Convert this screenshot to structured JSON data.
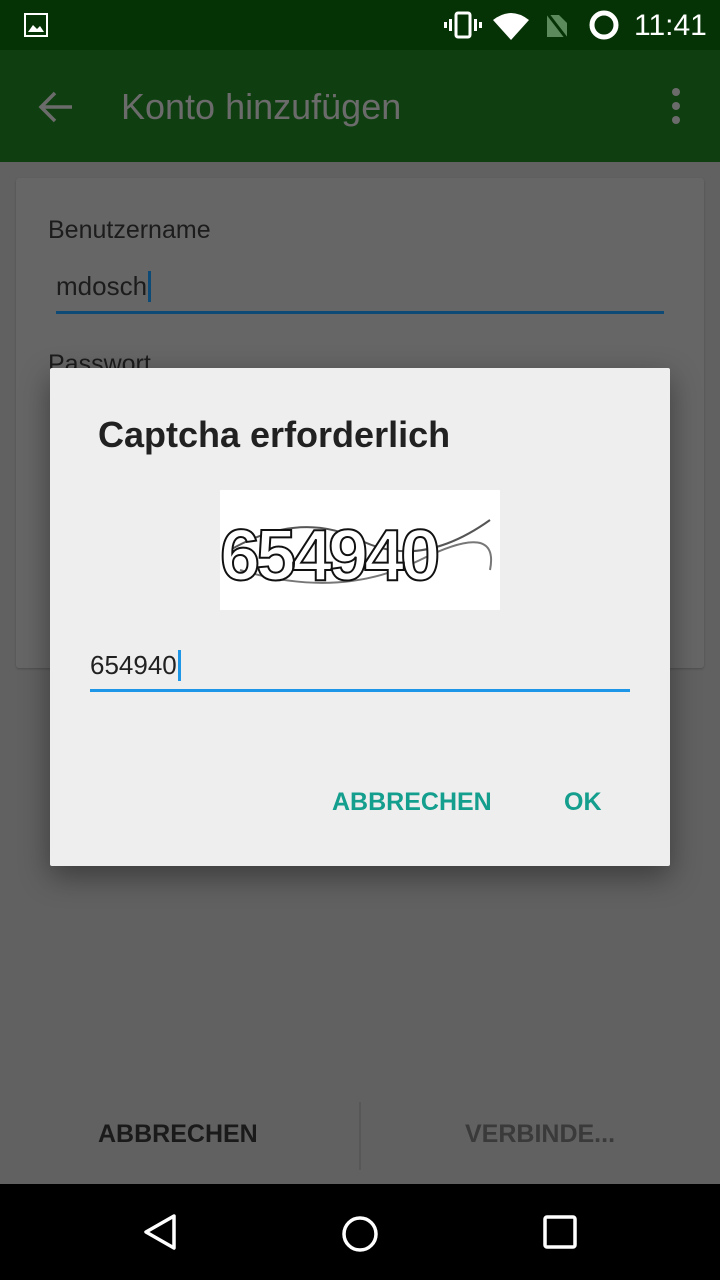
{
  "status_bar": {
    "time": "11:41",
    "icons": [
      "image-icon",
      "vibrate-icon",
      "wifi-icon",
      "no-sim-icon",
      "sync-icon"
    ]
  },
  "app_bar": {
    "title": "Konto hinzufügen",
    "back_icon": "arrow-left-icon",
    "menu_icon": "more-vert-icon"
  },
  "form": {
    "username_label": "Benutzername",
    "username_value": "mdosch",
    "password_label": "Passwort"
  },
  "bottom_bar": {
    "cancel": "ABBRECHEN",
    "connect": "VERBINDE..."
  },
  "dialog": {
    "title": "Captcha erforderlich",
    "captcha_image_text": "654940",
    "input_value": "654940",
    "cancel": "ABBRECHEN",
    "ok": "OK"
  },
  "colors": {
    "accent": "#139e8d",
    "input_underline": "#1e96e8"
  }
}
